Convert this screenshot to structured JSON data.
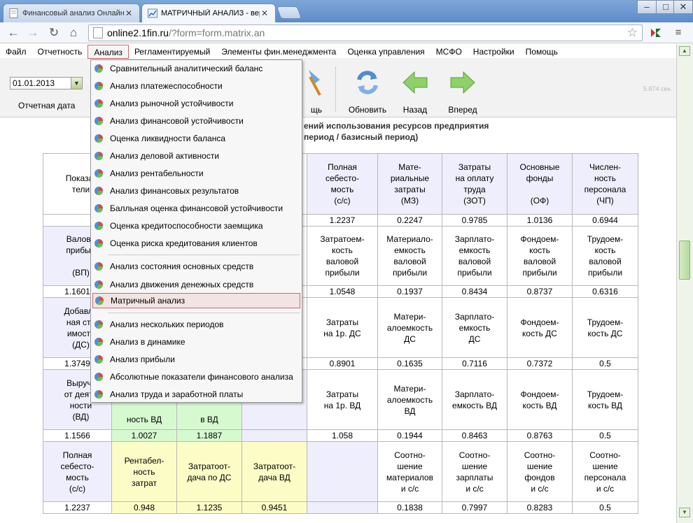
{
  "browser": {
    "tabs": [
      {
        "title": "Финансовый анализ Онлайн",
        "active": false
      },
      {
        "title": "МАТРИЧНЫЙ АНАЛИЗ - версия",
        "active": true
      }
    ],
    "url_host": "online2.1fin.ru",
    "url_path": "/?form=form.matrix.an"
  },
  "menubar": [
    "Файл",
    "Отчетность",
    "Анализ",
    "Регламентируемый",
    "Элементы фин.менеджмента",
    "Оценка управления",
    "МСФО",
    "Настройки",
    "Помощь"
  ],
  "panel": {
    "date_value": "01.01.2013",
    "date_label": "Отчетная дата",
    "help_label": "щь",
    "refresh_label": "Обновить",
    "back_label": "Назад",
    "forward_label": "Вперед",
    "timing": "5.874 сек."
  },
  "heading": {
    "line1": "ений использования ресурсов предприятия",
    "line2": "период / базисный период)"
  },
  "dropdown": {
    "items": [
      "Сравнительный аналитический баланс",
      "Анализ платежеспособности",
      "Анализ рыночной устойчивости",
      "Анализ финансовой устойчивости",
      "Оценка ликвидности баланса",
      "Анализ деловой активности",
      "Анализ рентабельности",
      "Анализ финансовых результатов",
      "Балльная оценка финансовой устойчивости",
      "Оценка кредитоспособности заемщика",
      "Оценка риска кредитования клиентов",
      "Анализ состояния основных средств",
      "Анализ движения денежных средств",
      "Матричный анализ",
      "Анализ нескольких периодов",
      "Анализ в динамике",
      "Анализ прибыли",
      "Абсолютные показатели финансового анализа",
      "Анализ труда и заработной платы"
    ],
    "highlighted": "Матричный анализ"
  },
  "matrix": {
    "header": [
      "Показа-\nтели",
      "",
      "",
      "",
      "Полная\nсебесто-\nмость\n(с/с)",
      "Мате-\nриальные\nзатраты\n(МЗ)",
      "Затраты\nна оплату\nтруда\n(ЗОТ)",
      "Основные\nфонды\n\n(ОФ)",
      "Числен-\nность\nперсонала\n(ЧП)"
    ],
    "header_values": [
      "1.2237",
      "0.2247",
      "0.9785",
      "1.0136",
      "0.6944"
    ],
    "rows": [
      {
        "label": "Валова\nприбыл\n\n(ВП)",
        "left_value": "1.1601",
        "cells": [
          "Затратоем-\nкость\nваловой\nприбыли",
          "Материало-\nемкость\nваловой\nприбыли",
          "Зарплато-\nемкость\nваловой\nприбыли",
          "Фондоем-\nкость\nваловой\nприбыли",
          "Трудоем-\nкость\nваловой\nприбыли"
        ],
        "values": [
          "1.0548",
          "0.1937",
          "0.8434",
          "0.8737",
          "0.6316"
        ]
      },
      {
        "label": "Добавле\nная сто\nимость\n(ДС)",
        "left_value": "1.3749",
        "cells": [
          "Затраты\nна 1р. ДС",
          "Матери-\nалоемкость\nДС",
          "Зарплато-\nемкость\nДС",
          "Фондоем-\nкость ДС",
          "Трудоем-\nкость ДС"
        ],
        "values": [
          "0.8901",
          "0.1635",
          "0.7116",
          "0.7372",
          "0.5"
        ]
      },
      {
        "label": "Выручк\nот деяте\nности\n(ВД)",
        "left_value": "1.1566",
        "green1_text": "ность ВД",
        "green1_value": "1.0027",
        "green2_text": "в ВД",
        "green2_value": "1.1887",
        "cells": [
          "Затраты\nна 1р. ВД",
          "Матери-\nалоемкость\nВД",
          "Зарплато-\nемкость ВД",
          "Фондоем-\nкость ВД",
          "Трудоем-\nкость ВД"
        ],
        "values": [
          "1.058",
          "0.1944",
          "0.8463",
          "0.8763",
          "0.5"
        ]
      },
      {
        "label": "Полная\nсебесто-\nмость\n(с/с)",
        "left_value": "1.2237",
        "yellow": [
          "Рентабел-\nность\nзатрат",
          "Затратоот-\nдача по ДС",
          "Затратоот-\nдача ВД"
        ],
        "yellow_values": [
          "0.948",
          "1.1235",
          "0.9451"
        ],
        "cells": [
          "Соотно-\nшение\nматериалов\nи с/с",
          "Соотно-\nшение\nзарплаты\nи с/с",
          "Соотно-\nшение\nфондов\nи с/с",
          "Соотно-\nшение\nперсонала\nи с/с"
        ],
        "values": [
          "0.1838",
          "0.7997",
          "0.8283",
          "0.5"
        ]
      }
    ]
  }
}
